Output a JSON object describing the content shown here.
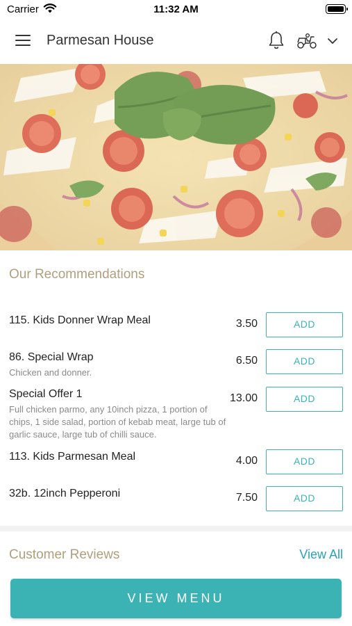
{
  "status_bar": {
    "carrier": "Carrier",
    "time": "11:32 AM"
  },
  "header": {
    "title": "Parmesan House"
  },
  "icons": {
    "menu": "hamburger-icon",
    "notifications": "bell-icon",
    "delivery": "scooter-icon",
    "dropdown": "chevron-down-icon"
  },
  "recommendations": {
    "title": "Our Recommendations",
    "add_label": "ADD",
    "items": [
      {
        "name": "115. Kids Donner Wrap Meal",
        "description": "",
        "price": "3.50"
      },
      {
        "name": "86. Special Wrap",
        "description": "Chicken and donner.",
        "price": "6.50"
      },
      {
        "name": "Special Offer 1",
        "description": "Full chicken parmo, any 10inch pizza, 1 portion of chips, 1 side salad, portion of kebab meat, large tub of garlic sauce, large tub of chilli sauce.",
        "price": "13.00"
      },
      {
        "name": "113. Kids Parmesan Meal",
        "description": "",
        "price": "4.00"
      },
      {
        "name": "32b. 12inch Pepperoni",
        "description": "",
        "price": "7.50"
      }
    ]
  },
  "reviews": {
    "title": "Customer Reviews",
    "view_all": "View All"
  },
  "cta": {
    "label": "VIEW MENU"
  },
  "colors": {
    "accent": "#3bb3b5",
    "section_title": "#b09e7c",
    "link": "#2aa1b8"
  }
}
